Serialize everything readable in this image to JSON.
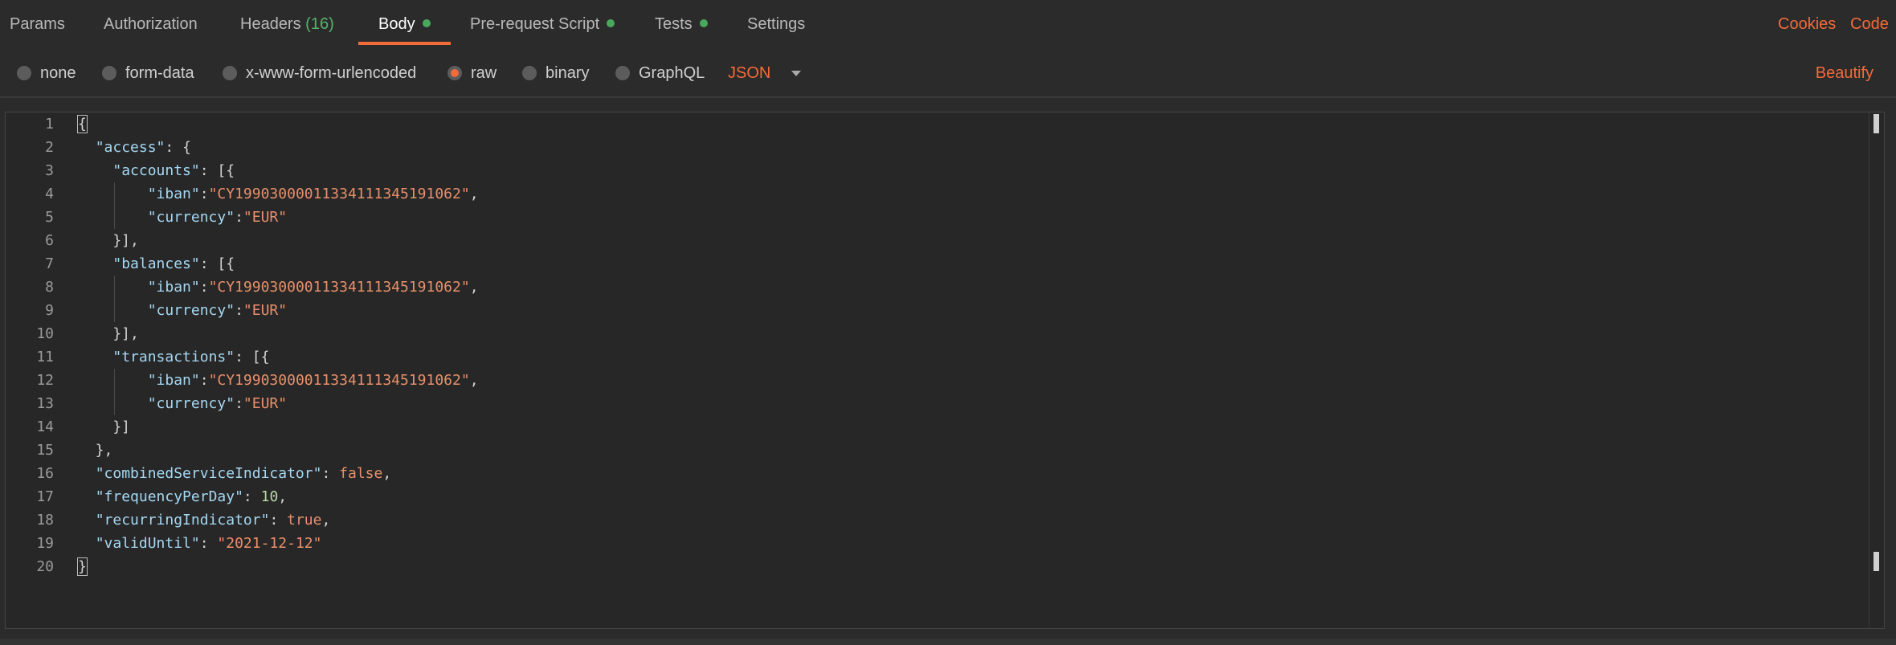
{
  "tabs": [
    {
      "label": "Params"
    },
    {
      "label": "Authorization"
    },
    {
      "label": "Headers",
      "count": "(16)"
    },
    {
      "label": "Body"
    },
    {
      "label": "Pre-request Script"
    },
    {
      "label": "Tests"
    },
    {
      "label": "Settings"
    }
  ],
  "links": {
    "cookies": "Cookies",
    "code": "Code"
  },
  "body_types": [
    {
      "label": "none",
      "selected": false
    },
    {
      "label": "form-data",
      "selected": false
    },
    {
      "label": "x-www-form-urlencoded",
      "selected": false
    },
    {
      "label": "raw",
      "selected": true
    },
    {
      "label": "binary",
      "selected": false
    },
    {
      "label": "GraphQL",
      "selected": false
    }
  ],
  "language": "JSON",
  "beautify": "Beautify",
  "colors": {
    "accent": "#f26b3a",
    "status_dot": "#4aa85d",
    "background": "#2b2b2b"
  },
  "editor": {
    "line_numbers": [
      "1",
      "2",
      "3",
      "4",
      "5",
      "6",
      "7",
      "8",
      "9",
      "10",
      "11",
      "12",
      "13",
      "14",
      "15",
      "16",
      "17",
      "18",
      "19",
      "20"
    ],
    "lines": [
      [
        {
          "t": "p",
          "v": "{"
        }
      ],
      [
        {
          "t": "p",
          "v": "  "
        },
        {
          "t": "k",
          "v": "\"access\""
        },
        {
          "t": "p",
          "v": ": {"
        }
      ],
      [
        {
          "t": "p",
          "v": "    "
        },
        {
          "t": "k",
          "v": "\"accounts\""
        },
        {
          "t": "p",
          "v": ": [{"
        }
      ],
      [
        {
          "t": "p",
          "v": "        "
        },
        {
          "t": "k",
          "v": "\"iban\""
        },
        {
          "t": "p",
          "v": ":"
        },
        {
          "t": "s",
          "v": "\"CY19903000011334111345191062\""
        },
        {
          "t": "p",
          "v": ","
        }
      ],
      [
        {
          "t": "p",
          "v": "        "
        },
        {
          "t": "k",
          "v": "\"currency\""
        },
        {
          "t": "p",
          "v": ":"
        },
        {
          "t": "s",
          "v": "\"EUR\""
        }
      ],
      [
        {
          "t": "p",
          "v": "    }],"
        }
      ],
      [
        {
          "t": "p",
          "v": "    "
        },
        {
          "t": "k",
          "v": "\"balances\""
        },
        {
          "t": "p",
          "v": ": [{"
        }
      ],
      [
        {
          "t": "p",
          "v": "        "
        },
        {
          "t": "k",
          "v": "\"iban\""
        },
        {
          "t": "p",
          "v": ":"
        },
        {
          "t": "s",
          "v": "\"CY19903000011334111345191062\""
        },
        {
          "t": "p",
          "v": ","
        }
      ],
      [
        {
          "t": "p",
          "v": "        "
        },
        {
          "t": "k",
          "v": "\"currency\""
        },
        {
          "t": "p",
          "v": ":"
        },
        {
          "t": "s",
          "v": "\"EUR\""
        }
      ],
      [
        {
          "t": "p",
          "v": "    }],"
        }
      ],
      [
        {
          "t": "p",
          "v": "    "
        },
        {
          "t": "k",
          "v": "\"transactions\""
        },
        {
          "t": "p",
          "v": ": [{"
        }
      ],
      [
        {
          "t": "p",
          "v": "        "
        },
        {
          "t": "k",
          "v": "\"iban\""
        },
        {
          "t": "p",
          "v": ":"
        },
        {
          "t": "s",
          "v": "\"CY19903000011334111345191062\""
        },
        {
          "t": "p",
          "v": ","
        }
      ],
      [
        {
          "t": "p",
          "v": "        "
        },
        {
          "t": "k",
          "v": "\"currency\""
        },
        {
          "t": "p",
          "v": ":"
        },
        {
          "t": "s",
          "v": "\"EUR\""
        }
      ],
      [
        {
          "t": "p",
          "v": "    }]"
        }
      ],
      [
        {
          "t": "p",
          "v": "  },"
        }
      ],
      [
        {
          "t": "p",
          "v": "  "
        },
        {
          "t": "k",
          "v": "\"combinedServiceIndicator\""
        },
        {
          "t": "p",
          "v": ": "
        },
        {
          "t": "b",
          "v": "false"
        },
        {
          "t": "p",
          "v": ","
        }
      ],
      [
        {
          "t": "p",
          "v": "  "
        },
        {
          "t": "k",
          "v": "\"frequencyPerDay\""
        },
        {
          "t": "p",
          "v": ": "
        },
        {
          "t": "n",
          "v": "10"
        },
        {
          "t": "p",
          "v": ","
        }
      ],
      [
        {
          "t": "p",
          "v": "  "
        },
        {
          "t": "k",
          "v": "\"recurringIndicator\""
        },
        {
          "t": "p",
          "v": ": "
        },
        {
          "t": "b",
          "v": "true"
        },
        {
          "t": "p",
          "v": ","
        }
      ],
      [
        {
          "t": "p",
          "v": "  "
        },
        {
          "t": "k",
          "v": "\"validUntil\""
        },
        {
          "t": "p",
          "v": ": "
        },
        {
          "t": "s",
          "v": "\"2021-12-12\""
        }
      ],
      [
        {
          "t": "p",
          "v": "}"
        }
      ]
    ]
  }
}
